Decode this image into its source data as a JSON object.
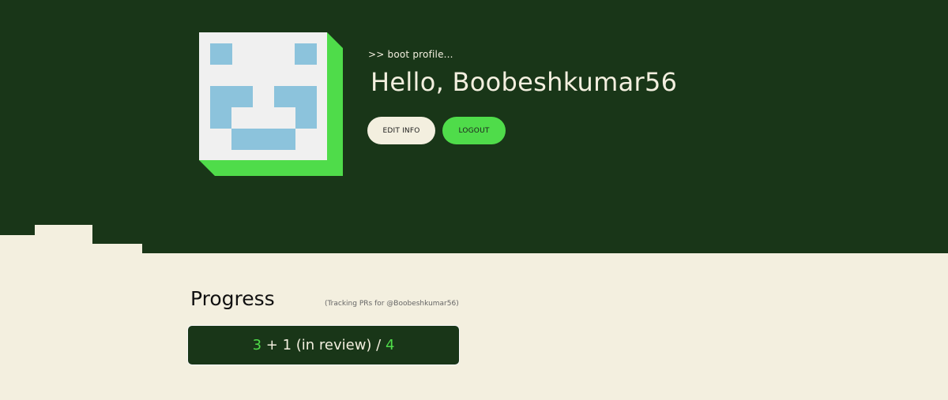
{
  "header": {
    "boot_text": ">> boot profile...",
    "greeting": "Hello, Boobeshkumar56",
    "edit_label": "EDIT INFO",
    "logout_label": "LOGOUT"
  },
  "avatar": {
    "icon": "pixel-smiley-avatar",
    "colors": {
      "face": "#f0f0f0",
      "features": "#8cc3dc",
      "shadow": "#4fdc4a"
    }
  },
  "progress": {
    "title": "Progress",
    "tracking": "(Tracking PRs for @Boobeshkumar56)",
    "merged": "3",
    "separator": " + ",
    "review": "1 (in review) / ",
    "total": "4"
  },
  "colors": {
    "hero_bg": "#193618",
    "page_bg": "#f3efdf",
    "accent": "#4fdc4a"
  }
}
